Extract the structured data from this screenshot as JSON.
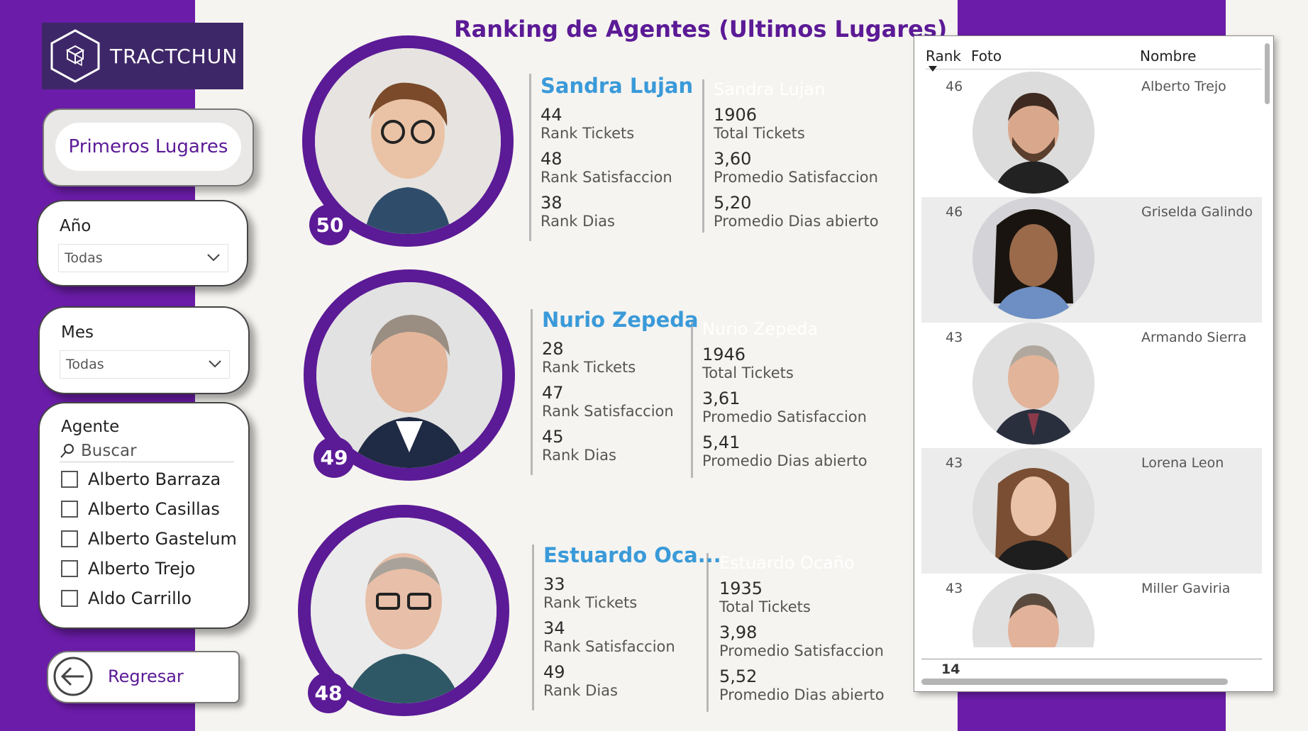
{
  "brand": {
    "name": "TRACTCHUN"
  },
  "nav": {
    "primeros_label": "Primeros Lugares",
    "back_label": "Regresar"
  },
  "filters": {
    "year": {
      "title": "Año",
      "value": "Todas"
    },
    "month": {
      "title": "Mes",
      "value": "Todas"
    },
    "agent": {
      "title": "Agente",
      "search_placeholder": "Buscar",
      "options": [
        "Alberto Barraza",
        "Alberto Casillas",
        "Alberto Gastelum",
        "Alberto Trejo",
        "Aldo Carrillo"
      ]
    }
  },
  "page_title": "Ranking de Agentes (Ultimos Lugares)",
  "agents": [
    {
      "position": "50",
      "name": "Sandra Lujan",
      "rank_tickets": "44",
      "rank_tickets_label": "Rank Tickets",
      "rank_satisfaccion": "48",
      "rank_satisfaccion_label": "Rank Satisfaccion",
      "rank_dias": "38",
      "rank_dias_label": "Rank Dias",
      "total_tickets": "1906",
      "total_tickets_label": "Total Tickets",
      "prom_satisfaccion": "3,60",
      "prom_satisfaccion_label": "Promedio Satisfaccion",
      "prom_dias": "5,20",
      "prom_dias_label": "Promedio Dias abierto"
    },
    {
      "position": "49",
      "name": "Nurio Zepeda",
      "rank_tickets": "28",
      "rank_tickets_label": "Rank Tickets",
      "rank_satisfaccion": "47",
      "rank_satisfaccion_label": "Rank Satisfaccion",
      "rank_dias": "45",
      "rank_dias_label": "Rank Dias",
      "total_tickets": "1946",
      "total_tickets_label": "Total Tickets",
      "prom_satisfaccion": "3,61",
      "prom_satisfaccion_label": "Promedio Satisfaccion",
      "prom_dias": "5,41",
      "prom_dias_label": "Promedio Dias abierto"
    },
    {
      "position": "48",
      "name": "Estuardo Oca...",
      "full_name": "Estuardo Ocaño",
      "rank_tickets": "33",
      "rank_tickets_label": "Rank Tickets",
      "rank_satisfaccion": "34",
      "rank_satisfaccion_label": "Rank Satisfaccion",
      "rank_dias": "49",
      "rank_dias_label": "Rank Dias",
      "total_tickets": "1935",
      "total_tickets_label": "Total Tickets",
      "prom_satisfaccion": "3,98",
      "prom_satisfaccion_label": "Promedio Satisfaccion",
      "prom_dias": "5,52",
      "prom_dias_label": "Promedio Dias abierto"
    }
  ],
  "table": {
    "columns": [
      "Rank",
      "Foto",
      "Nombre"
    ],
    "rows": [
      {
        "rank": "46",
        "name": "Alberto Trejo"
      },
      {
        "rank": "46",
        "name": "Griselda Galindo"
      },
      {
        "rank": "43",
        "name": "Armando Sierra"
      },
      {
        "rank": "43",
        "name": "Lorena Leon"
      },
      {
        "rank": "43",
        "name": "Miller Gaviria"
      }
    ],
    "total": "14"
  },
  "colors": {
    "purple": "#5b1a96",
    "band": "#6b1ca8",
    "name_blue": "#3a9ad9"
  }
}
